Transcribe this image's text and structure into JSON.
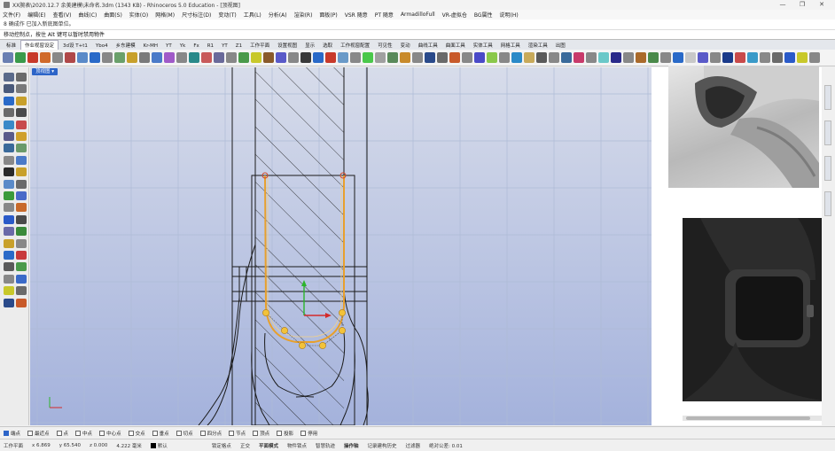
{
  "window": {
    "title": "XX腕表\\2020.12.7 余美建模\\未命名.3dm (1343 KB) - Rhinoceros 5.0 Education - [顶视图]",
    "controls": [
      "—",
      "❐",
      "✕"
    ]
  },
  "menu": [
    "文件(F)",
    "编辑(E)",
    "查看(V)",
    "曲线(C)",
    "曲面(S)",
    "实体(O)",
    "网格(M)",
    "尺寸标注(D)",
    "变动(T)",
    "工具(L)",
    "分析(A)",
    "渲染(R)",
    "面板(P)",
    "VSR 随意",
    "PT 随意",
    "ArmadilloFull",
    "VR-虚拟仓",
    "BG属性",
    "说明(H)"
  ],
  "command_history": "8 确成作 已加入新底图单位。",
  "command_prompt": "移动控制点，按住 Alt 键可以暂时禁用物件",
  "tabs": [
    {
      "label": "标准",
      "active": false
    },
    {
      "label": "作业视窗设定",
      "active": true
    },
    {
      "label": "3d设 T+t1",
      "active": false
    },
    {
      "label": "Ybo4",
      "active": false
    },
    {
      "label": "乡东建模",
      "active": false
    },
    {
      "label": "Kr-MH",
      "active": false
    },
    {
      "label": "YT",
      "active": false
    },
    {
      "label": "Yk",
      "active": false
    },
    {
      "label": "Fx",
      "active": false
    },
    {
      "label": "R1",
      "active": false
    },
    {
      "label": "YT",
      "active": false
    },
    {
      "label": "Z1",
      "active": false
    },
    {
      "label": "工作平面",
      "active": false
    },
    {
      "label": "设置视图",
      "active": false
    },
    {
      "label": "显示",
      "active": false
    },
    {
      "label": "选取",
      "active": false
    },
    {
      "label": "工作视窗配置",
      "active": false
    },
    {
      "label": "可见性",
      "active": false
    },
    {
      "label": "变动",
      "active": false
    },
    {
      "label": "曲线工具",
      "active": false
    },
    {
      "label": "曲面工具",
      "active": false
    },
    {
      "label": "实体工具",
      "active": false
    },
    {
      "label": "网格工具",
      "active": false
    },
    {
      "label": "渲染工具",
      "active": false
    },
    {
      "label": "出图",
      "active": false
    }
  ],
  "viewport": {
    "name": "顶视图 ▾"
  },
  "osnap": [
    {
      "label": "端点",
      "on": true
    },
    {
      "label": "最近点",
      "on": false
    },
    {
      "label": "点",
      "on": false
    },
    {
      "label": "中点",
      "on": false
    },
    {
      "label": "中心点",
      "on": false
    },
    {
      "label": "交点",
      "on": false
    },
    {
      "label": "垂点",
      "on": false
    },
    {
      "label": "切点",
      "on": false
    },
    {
      "label": "四分点",
      "on": false
    },
    {
      "label": "节点",
      "on": false
    },
    {
      "label": "顶点",
      "on": false
    },
    {
      "label": "投影",
      "on": false
    },
    {
      "label": "停用",
      "on": false
    }
  ],
  "status": {
    "cplane": "工作平面",
    "x": "x 6.869",
    "y": "y 65.540",
    "z": "z 0.000",
    "dist": "4.222 毫米",
    "layer": "默认",
    "panes": [
      "锁定格点",
      "正交",
      "平面模式",
      "物件锁点",
      "智慧轨迹",
      "操作轴",
      "记录建构历史",
      "过滤器",
      "绝对公差: 0.01"
    ],
    "bold": [
      false,
      false,
      true,
      false,
      false,
      true,
      false,
      false,
      false
    ]
  },
  "colors": {
    "viewport_top": "#d4dae8",
    "viewport_bottom": "#a6b4dc",
    "grid": "#aebbd6",
    "curve": "#1a1a1a",
    "selected": "#e8a02c",
    "handle": "#f2c23a",
    "accent": "#2c64c8"
  }
}
